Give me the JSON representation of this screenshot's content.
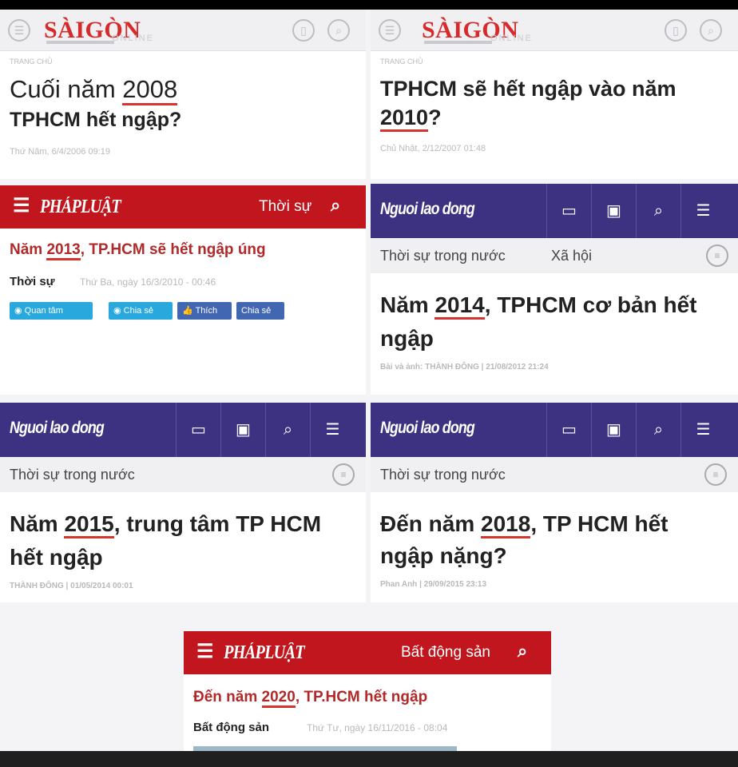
{
  "panels": {
    "p1": {
      "brand": "SÀIGÒN",
      "brand_suffix": "ONLINE",
      "breadcrumb": "TRANG CHỦ",
      "title_pre": "Cuối năm ",
      "title_year": "2008",
      "title_post": "TPHCM hết ngập?",
      "date": "Thứ Năm, 6/4/2006 09:19"
    },
    "p2": {
      "brand": "SÀIGÒN",
      "brand_suffix": "ONLINE",
      "breadcrumb": "TRANG CHỦ",
      "title_pre": "TPHCM sẽ hết ngập vào năm",
      "title_year": "2010",
      "title_post": "?",
      "date": "Chủ Nhật, 2/12/2007 01:48"
    },
    "p3": {
      "brand": "PHÁPLUẬT",
      "section": "Thời sự",
      "title_pre": "Năm ",
      "title_year": "2013",
      "title_post": ", TP.HCM sẽ hết ngập úng",
      "category": "Thời sự",
      "date": "Thứ Ba, ngày 16/3/2010 - 00:46",
      "buttons": [
        "Quan tâm",
        "Chia sẻ",
        "Thích",
        "Chia sẻ"
      ]
    },
    "p4": {
      "brand": "Nguoi lao dong",
      "subnav": [
        "Thời sự trong nước",
        "Xã hội"
      ],
      "title_pre": "Năm ",
      "title_year": "2014",
      "title_post": ", TPHCM cơ bản hết",
      "title_line2": "ngập",
      "byline": "Bài và ảnh: THÀNH ĐÔNG | 21/08/2012 21:24"
    },
    "p5": {
      "brand": "Nguoi lao dong",
      "subnav": [
        "Thời sự trong nước"
      ],
      "title_pre": "Năm ",
      "title_year": "2015",
      "title_post": ", trung tâm TP HCM",
      "title_line2": "hết ngập",
      "byline": "THÀNH ĐÔNG | 01/05/2014 00:01"
    },
    "p6": {
      "brand": "Nguoi lao dong",
      "subnav": [
        "Thời sự trong nước"
      ],
      "title_pre": "Đến năm ",
      "title_year": "2018",
      "title_post": ", TP HCM hết",
      "title_line2": "ngập nặng?",
      "byline": "Phan Anh | 29/09/2015 23:13"
    },
    "p7": {
      "brand": "PHÁPLUẬT",
      "section": "Bất động sản",
      "title_pre": "Đến năm ",
      "title_year": "2020",
      "title_post": ", TP.HCM hết ngập",
      "category": "Bất động sản",
      "date": "Thứ Tư, ngày 16/11/2016 - 08:04"
    }
  },
  "colors": {
    "saigon_red": "#d72a2a",
    "phapluat_red": "#c1161d",
    "nld_purple": "#3d3281",
    "underline": "#d8342f"
  }
}
